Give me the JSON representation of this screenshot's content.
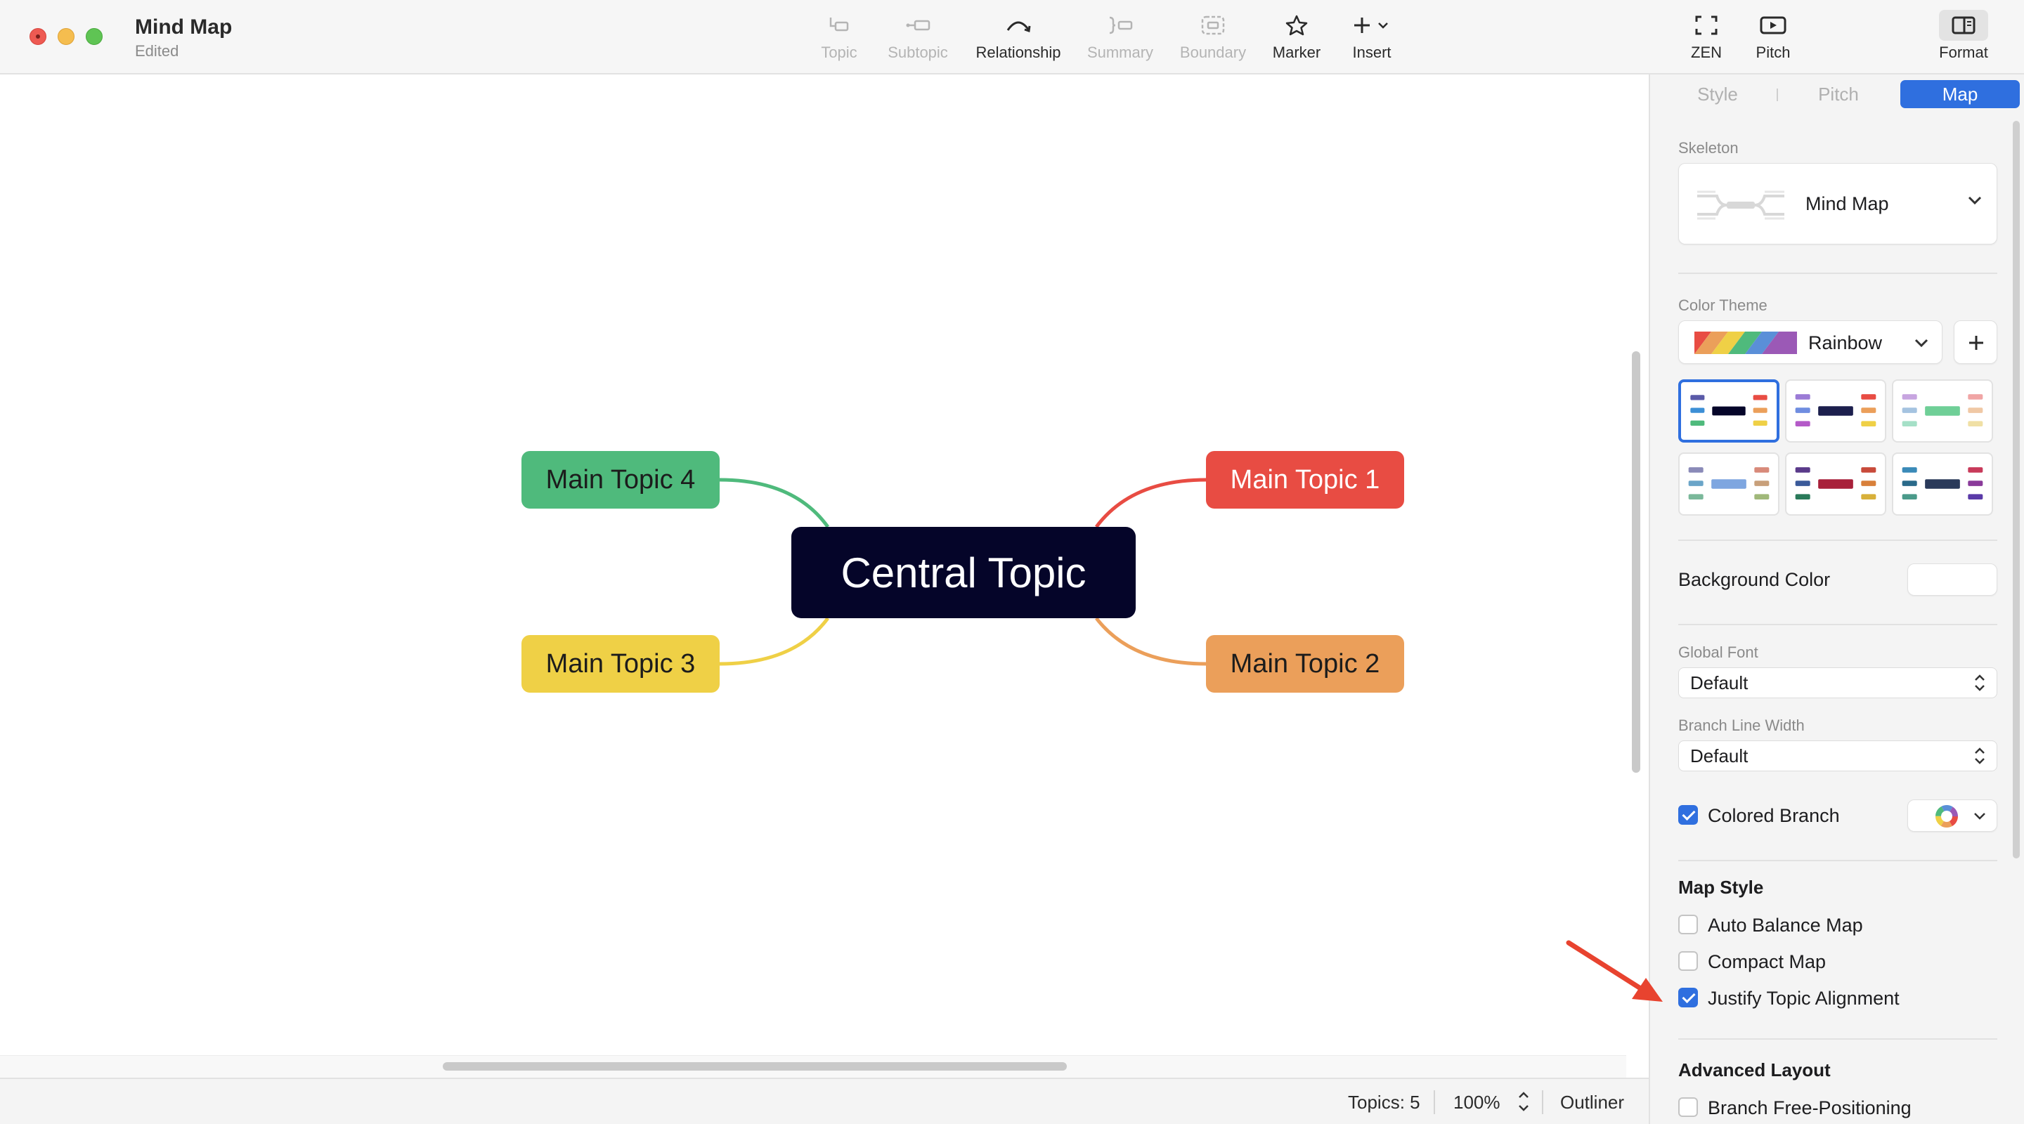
{
  "window": {
    "title": "Mind Map",
    "status": "Edited"
  },
  "toolbar": {
    "topic": "Topic",
    "subtopic": "Subtopic",
    "relationship": "Relationship",
    "summary": "Summary",
    "boundary": "Boundary",
    "marker": "Marker",
    "insert": "Insert",
    "zen": "ZEN",
    "pitch": "Pitch",
    "format": "Format"
  },
  "canvas": {
    "central_topic": "Central Topic",
    "topics": [
      "Main Topic 1",
      "Main Topic 2",
      "Main Topic 3",
      "Main Topic 4"
    ],
    "branch_colors": [
      "#e84c43",
      "#eb9f5a",
      "#efd046",
      "#4fba7c"
    ]
  },
  "statusbar": {
    "topics": "Topics: 5",
    "zoom": "100%",
    "outliner": "Outliner"
  },
  "panel": {
    "tabs": [
      "Style",
      "Pitch",
      "Map"
    ],
    "active_tab": "Map",
    "skeleton_label": "Skeleton",
    "skeleton_value": "Mind Map",
    "color_theme_label": "Color Theme",
    "color_theme_value": "Rainbow",
    "background_color_label": "Background Color",
    "global_font_label": "Global Font",
    "global_font_value": "Default",
    "branch_line_width_label": "Branch Line Width",
    "branch_line_width_value": "Default",
    "colored_branch_label": "Colored Branch",
    "map_style_head": "Map Style",
    "auto_balance_label": "Auto Balance Map",
    "compact_map_label": "Compact Map",
    "justify_label": "Justify Topic Alignment",
    "advanced_layout_head": "Advanced Layout",
    "branch_free_label": "Branch Free-Positioning",
    "accent": "#2f6fdf"
  }
}
